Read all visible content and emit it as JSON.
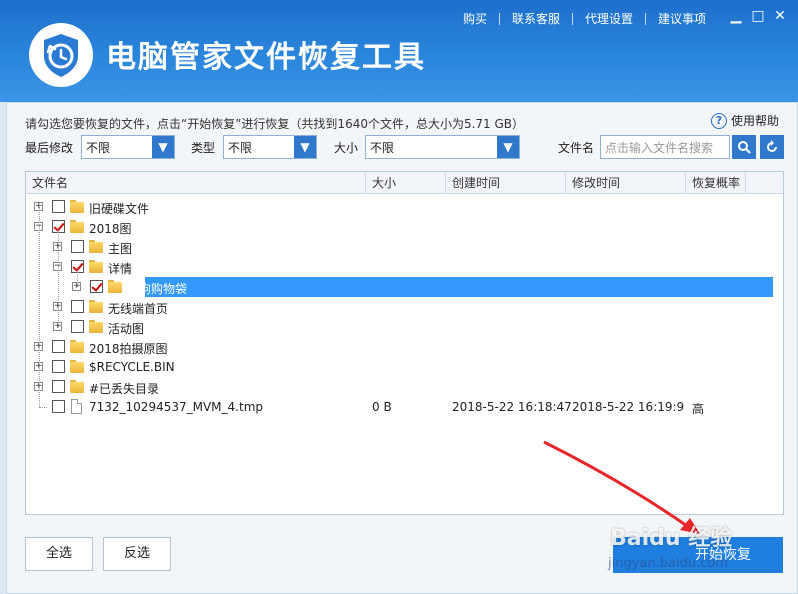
{
  "app": {
    "title": "电脑管家文件恢复工具"
  },
  "topnav": [
    {
      "label": "购买"
    },
    {
      "label": "联系客服"
    },
    {
      "label": "代理设置"
    },
    {
      "label": "建议事项"
    }
  ],
  "window": {
    "minimize": "▁",
    "maximize": "□",
    "close": "✕"
  },
  "notice": "请勾选您要恢复的文件，点击“开始恢复”进行恢复（共找到1640个文件，总大小为5.71 GB）",
  "help": {
    "icon": "?",
    "label": "使用帮助"
  },
  "filters": {
    "modified_label": "最后修改",
    "modified_value": "不限",
    "type_label": "类型",
    "type_value": "不限",
    "size_label": "大小",
    "size_value": "不限",
    "filename_label": "文件名",
    "filename_placeholder": "点击输入文件名搜索"
  },
  "columns": [
    "文件名",
    "大小",
    "创建时间",
    "修改时间",
    "恢复概率"
  ],
  "tree": [
    {
      "label": "旧硬碟文件",
      "checked": false,
      "expander": "+",
      "kind": "folder"
    },
    {
      "label": "2018图",
      "checked": true,
      "expander": "−",
      "kind": "folder"
    },
    {
      "label": "主图",
      "checked": false,
      "expander": "+",
      "kind": "folder"
    },
    {
      "label": "详情",
      "checked": true,
      "expander": "−",
      "kind": "folder"
    },
    {
      "label": "小狗购物袋",
      "checked": true,
      "expander": "+",
      "kind": "folder",
      "selected": true
    },
    {
      "label": "无线端首页",
      "checked": false,
      "expander": "+",
      "kind": "folder"
    },
    {
      "label": "活动图",
      "checked": false,
      "expander": "+",
      "kind": "folder"
    },
    {
      "label": "2018拍摄原图",
      "checked": false,
      "expander": "+",
      "kind": "folder"
    },
    {
      "label": "$RECYCLE.BIN",
      "checked": false,
      "expander": "+",
      "kind": "folder"
    },
    {
      "label": "#已丢失目录",
      "checked": false,
      "expander": "+",
      "kind": "folder"
    },
    {
      "label": "7132_10294537_MVM_4.tmp",
      "checked": false,
      "kind": "file",
      "size": "0 B",
      "created": "2018-5-22 16:18:47",
      "modified": "2018-5-22 16:19:9",
      "probability": "高"
    }
  ],
  "buttons": {
    "select_all": "全选",
    "invert": "反选",
    "start": "开始恢复"
  },
  "watermark": {
    "brand": "Baidu 经验",
    "url": "jingyan.baidu.com"
  },
  "colors": {
    "header": "#2a86dc",
    "accent": "#2f78cc",
    "selection": "#3399ff",
    "check": "#d40000",
    "arrow": "#e8262b"
  }
}
